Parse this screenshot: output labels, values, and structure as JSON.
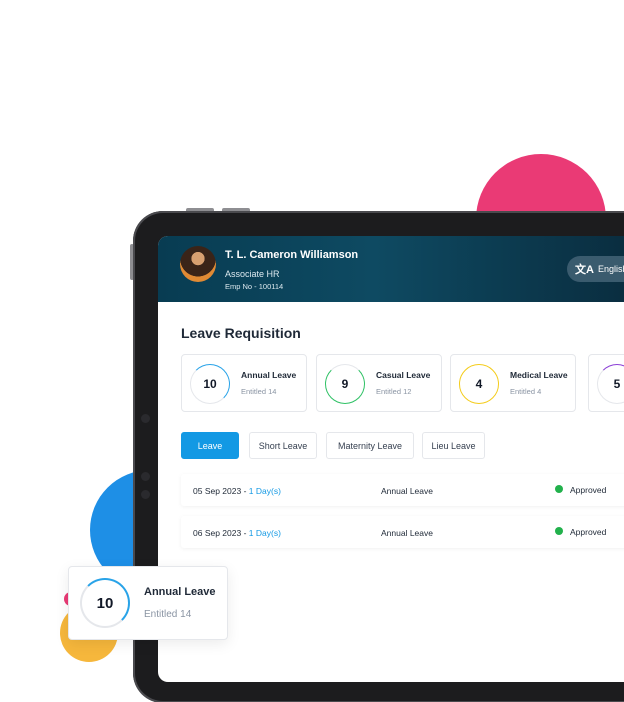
{
  "user": {
    "name": "T. L. Cameron Williamson",
    "role": "Associate HR",
    "emp_no": "Emp No - 100114"
  },
  "language": {
    "label": "English",
    "icon": "translate-icon"
  },
  "page_title": "Leave Requisition",
  "leave_cards": [
    {
      "count": "10",
      "title": "Annual Leave",
      "entitled": "Entitled 14",
      "color": "#29a3e8"
    },
    {
      "count": "9",
      "title": "Casual Leave",
      "entitled": "Entitled 12",
      "color": "#2fc165"
    },
    {
      "count": "4",
      "title": "Medical Leave",
      "entitled": "Entitled 4",
      "color": "#f4cc1b"
    },
    {
      "count": "5",
      "color": "#8b3fd6"
    }
  ],
  "tabs": [
    {
      "label": "Leave",
      "active": true
    },
    {
      "label": "Short Leave"
    },
    {
      "label": "Maternity Leave"
    },
    {
      "label": "Lieu Leave"
    }
  ],
  "leave_rows": [
    {
      "date": "05 Sep 2023",
      "days": "1 Day(s)",
      "type": "Annual Leave",
      "status": "Approved"
    },
    {
      "date": "06 Sep 2023",
      "days": "1 Day(s)",
      "type": "Annual Leave",
      "status": "Approved"
    }
  ],
  "floating_card": {
    "count": "10",
    "title": "Annual Leave",
    "entitled": "Entitled 14"
  },
  "colors": {
    "accent": "#1399e4",
    "approved": "#22b14c",
    "header": "#0e4a62"
  }
}
